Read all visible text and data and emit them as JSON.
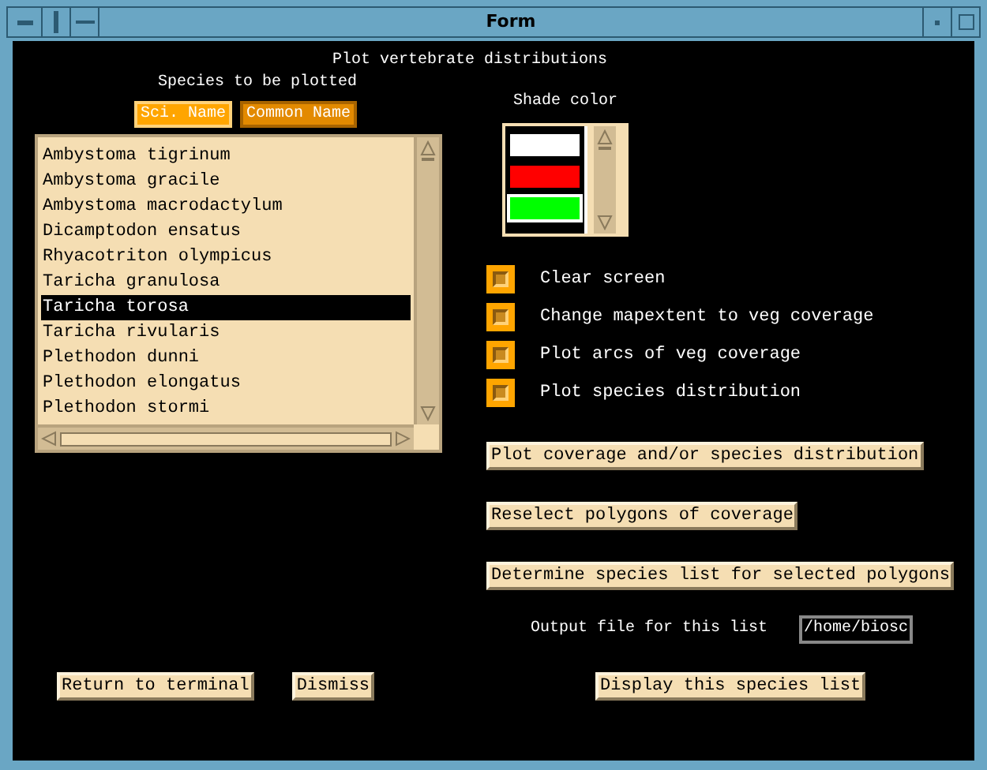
{
  "window": {
    "title": "Form"
  },
  "heading": "Plot vertebrate distributions",
  "species_label": "Species to be plotted",
  "sort_buttons": [
    {
      "label": "Sci. Name",
      "selected": true
    },
    {
      "label": "Common Name",
      "selected": false
    }
  ],
  "species": [
    {
      "label": "Ambystoma tigrinum",
      "selected": false
    },
    {
      "label": "Ambystoma gracile",
      "selected": false
    },
    {
      "label": "Ambystoma macrodactylum",
      "selected": false
    },
    {
      "label": "Dicamptodon ensatus",
      "selected": false
    },
    {
      "label": "Rhyacotriton olympicus",
      "selected": false
    },
    {
      "label": "Taricha granulosa",
      "selected": false
    },
    {
      "label": "Taricha torosa",
      "selected": true
    },
    {
      "label": "Taricha rivularis",
      "selected": false
    },
    {
      "label": "Plethodon dunni",
      "selected": false
    },
    {
      "label": "Plethodon elongatus",
      "selected": false
    },
    {
      "label": "Plethodon stormi",
      "selected": false
    }
  ],
  "shade_label": "Shade color",
  "shade_colors": [
    {
      "color": "#ffffff",
      "selected": false
    },
    {
      "color": "#ff0000",
      "selected": false
    },
    {
      "color": "#00ff00",
      "selected": true
    }
  ],
  "options": [
    {
      "label": "Clear screen",
      "checked": true
    },
    {
      "label": "Change mapextent to veg coverage",
      "checked": true
    },
    {
      "label": "Plot arcs of veg coverage",
      "checked": true
    },
    {
      "label": "Plot species distribution",
      "checked": true
    }
  ],
  "actions": [
    "Plot coverage and/or species distribution",
    "Reselect polygons of coverage",
    "Determine species list for selected polygons"
  ],
  "output": {
    "label": "Output file for this list",
    "value": "/home/biosc"
  },
  "bottom_buttons": [
    "Return to terminal",
    "Dismiss",
    "Display this species list"
  ]
}
